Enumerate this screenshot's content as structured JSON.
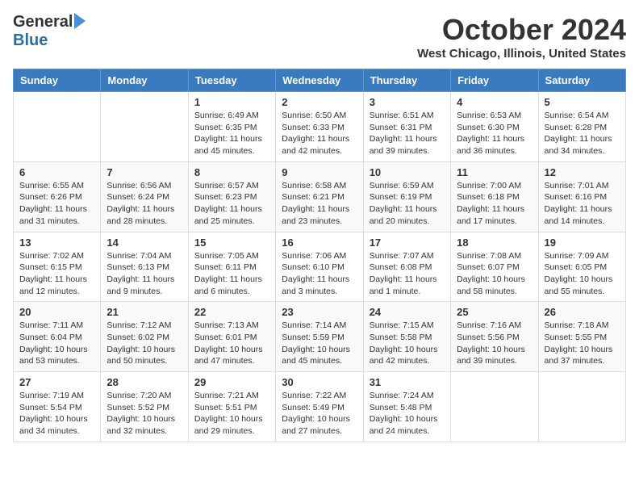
{
  "header": {
    "logo_general": "General",
    "logo_blue": "Blue",
    "month_title": "October 2024",
    "location": "West Chicago, Illinois, United States"
  },
  "days_of_week": [
    "Sunday",
    "Monday",
    "Tuesday",
    "Wednesday",
    "Thursday",
    "Friday",
    "Saturday"
  ],
  "weeks": [
    [
      {
        "day": "",
        "info": ""
      },
      {
        "day": "",
        "info": ""
      },
      {
        "day": "1",
        "info": "Sunrise: 6:49 AM\nSunset: 6:35 PM\nDaylight: 11 hours and 45 minutes."
      },
      {
        "day": "2",
        "info": "Sunrise: 6:50 AM\nSunset: 6:33 PM\nDaylight: 11 hours and 42 minutes."
      },
      {
        "day": "3",
        "info": "Sunrise: 6:51 AM\nSunset: 6:31 PM\nDaylight: 11 hours and 39 minutes."
      },
      {
        "day": "4",
        "info": "Sunrise: 6:53 AM\nSunset: 6:30 PM\nDaylight: 11 hours and 36 minutes."
      },
      {
        "day": "5",
        "info": "Sunrise: 6:54 AM\nSunset: 6:28 PM\nDaylight: 11 hours and 34 minutes."
      }
    ],
    [
      {
        "day": "6",
        "info": "Sunrise: 6:55 AM\nSunset: 6:26 PM\nDaylight: 11 hours and 31 minutes."
      },
      {
        "day": "7",
        "info": "Sunrise: 6:56 AM\nSunset: 6:24 PM\nDaylight: 11 hours and 28 minutes."
      },
      {
        "day": "8",
        "info": "Sunrise: 6:57 AM\nSunset: 6:23 PM\nDaylight: 11 hours and 25 minutes."
      },
      {
        "day": "9",
        "info": "Sunrise: 6:58 AM\nSunset: 6:21 PM\nDaylight: 11 hours and 23 minutes."
      },
      {
        "day": "10",
        "info": "Sunrise: 6:59 AM\nSunset: 6:19 PM\nDaylight: 11 hours and 20 minutes."
      },
      {
        "day": "11",
        "info": "Sunrise: 7:00 AM\nSunset: 6:18 PM\nDaylight: 11 hours and 17 minutes."
      },
      {
        "day": "12",
        "info": "Sunrise: 7:01 AM\nSunset: 6:16 PM\nDaylight: 11 hours and 14 minutes."
      }
    ],
    [
      {
        "day": "13",
        "info": "Sunrise: 7:02 AM\nSunset: 6:15 PM\nDaylight: 11 hours and 12 minutes."
      },
      {
        "day": "14",
        "info": "Sunrise: 7:04 AM\nSunset: 6:13 PM\nDaylight: 11 hours and 9 minutes."
      },
      {
        "day": "15",
        "info": "Sunrise: 7:05 AM\nSunset: 6:11 PM\nDaylight: 11 hours and 6 minutes."
      },
      {
        "day": "16",
        "info": "Sunrise: 7:06 AM\nSunset: 6:10 PM\nDaylight: 11 hours and 3 minutes."
      },
      {
        "day": "17",
        "info": "Sunrise: 7:07 AM\nSunset: 6:08 PM\nDaylight: 11 hours and 1 minute."
      },
      {
        "day": "18",
        "info": "Sunrise: 7:08 AM\nSunset: 6:07 PM\nDaylight: 10 hours and 58 minutes."
      },
      {
        "day": "19",
        "info": "Sunrise: 7:09 AM\nSunset: 6:05 PM\nDaylight: 10 hours and 55 minutes."
      }
    ],
    [
      {
        "day": "20",
        "info": "Sunrise: 7:11 AM\nSunset: 6:04 PM\nDaylight: 10 hours and 53 minutes."
      },
      {
        "day": "21",
        "info": "Sunrise: 7:12 AM\nSunset: 6:02 PM\nDaylight: 10 hours and 50 minutes."
      },
      {
        "day": "22",
        "info": "Sunrise: 7:13 AM\nSunset: 6:01 PM\nDaylight: 10 hours and 47 minutes."
      },
      {
        "day": "23",
        "info": "Sunrise: 7:14 AM\nSunset: 5:59 PM\nDaylight: 10 hours and 45 minutes."
      },
      {
        "day": "24",
        "info": "Sunrise: 7:15 AM\nSunset: 5:58 PM\nDaylight: 10 hours and 42 minutes."
      },
      {
        "day": "25",
        "info": "Sunrise: 7:16 AM\nSunset: 5:56 PM\nDaylight: 10 hours and 39 minutes."
      },
      {
        "day": "26",
        "info": "Sunrise: 7:18 AM\nSunset: 5:55 PM\nDaylight: 10 hours and 37 minutes."
      }
    ],
    [
      {
        "day": "27",
        "info": "Sunrise: 7:19 AM\nSunset: 5:54 PM\nDaylight: 10 hours and 34 minutes."
      },
      {
        "day": "28",
        "info": "Sunrise: 7:20 AM\nSunset: 5:52 PM\nDaylight: 10 hours and 32 minutes."
      },
      {
        "day": "29",
        "info": "Sunrise: 7:21 AM\nSunset: 5:51 PM\nDaylight: 10 hours and 29 minutes."
      },
      {
        "day": "30",
        "info": "Sunrise: 7:22 AM\nSunset: 5:49 PM\nDaylight: 10 hours and 27 minutes."
      },
      {
        "day": "31",
        "info": "Sunrise: 7:24 AM\nSunset: 5:48 PM\nDaylight: 10 hours and 24 minutes."
      },
      {
        "day": "",
        "info": ""
      },
      {
        "day": "",
        "info": ""
      }
    ]
  ]
}
